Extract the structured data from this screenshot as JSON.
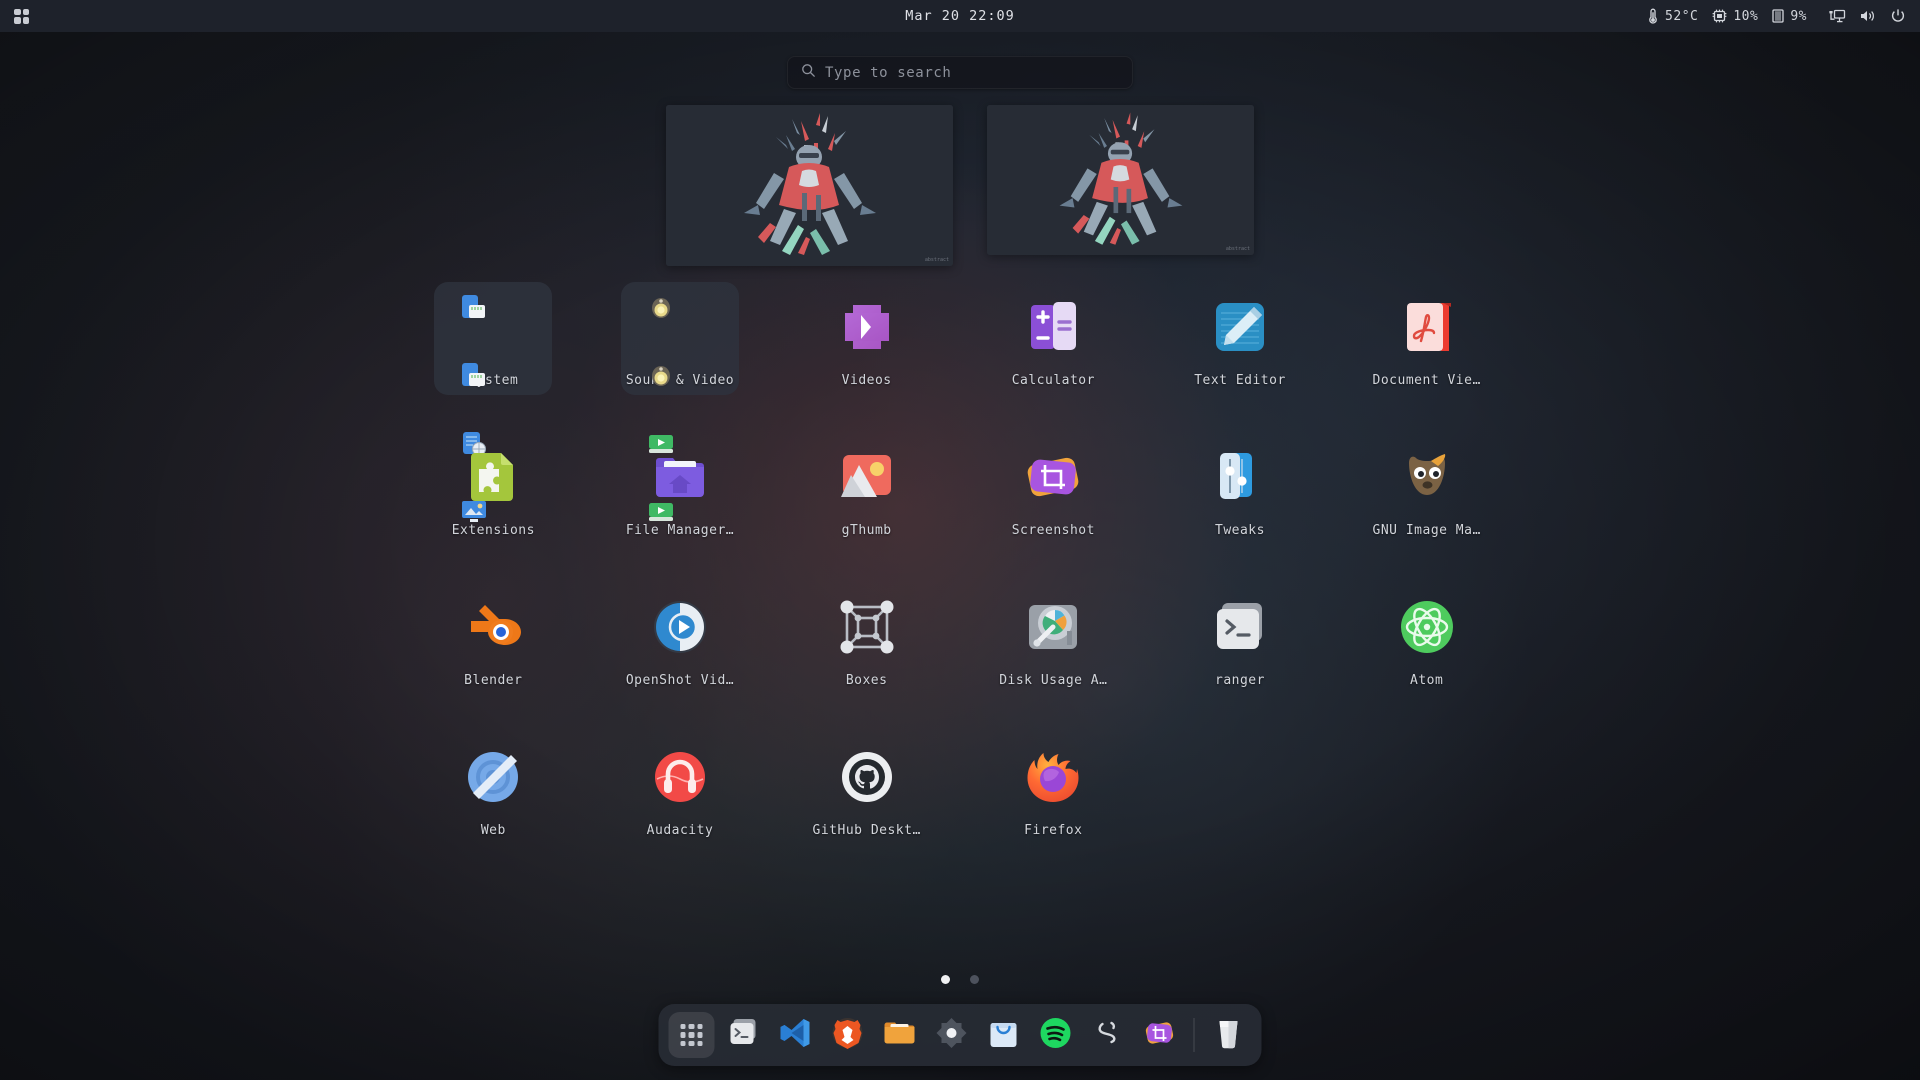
{
  "topbar": {
    "activities_icon": "grid-apps-icon",
    "clock": "Mar 20 22:09",
    "status": {
      "temperature_icon": "thermometer-icon",
      "temperature": "52°C",
      "cpu_icon": "cpu-chip-icon",
      "cpu": "10%",
      "memory_icon": "memory-icon",
      "memory": "9%",
      "network_icon": "network-wired-icon",
      "volume_icon": "speaker-volume-icon",
      "power_icon": "power-icon"
    }
  },
  "search": {
    "icon": "search-icon",
    "value": "",
    "placeholder": "Type to search"
  },
  "workspaces": [
    {
      "name": "workspace-1",
      "tag": "abstract"
    },
    {
      "name": "workspace-2",
      "tag": "abstract"
    }
  ],
  "apps": [
    {
      "label": "System",
      "icon": "folder-system-icon",
      "type": "folder"
    },
    {
      "label": "Sound & Video",
      "icon": "folder-sound-video-icon",
      "type": "folder"
    },
    {
      "label": "Videos",
      "icon": "videos-icon",
      "type": "app"
    },
    {
      "label": "Calculator",
      "icon": "calculator-icon",
      "type": "app"
    },
    {
      "label": "Text Editor",
      "icon": "text-editor-icon",
      "type": "app"
    },
    {
      "label": "Document Vie…",
      "icon": "document-viewer-icon",
      "type": "app"
    },
    {
      "label": "Extensions",
      "icon": "extensions-icon",
      "type": "app"
    },
    {
      "label": "File Manager…",
      "icon": "file-manager-icon",
      "type": "app"
    },
    {
      "label": "gThumb",
      "icon": "gthumb-icon",
      "type": "app"
    },
    {
      "label": "Screenshot",
      "icon": "screenshot-icon",
      "type": "app"
    },
    {
      "label": "Tweaks",
      "icon": "tweaks-icon",
      "type": "app"
    },
    {
      "label": "GNU Image Ma…",
      "icon": "gimp-icon",
      "type": "app"
    },
    {
      "label": "Blender",
      "icon": "blender-icon",
      "type": "app"
    },
    {
      "label": "OpenShot Vid…",
      "icon": "openshot-icon",
      "type": "app"
    },
    {
      "label": "Boxes",
      "icon": "boxes-icon",
      "type": "app"
    },
    {
      "label": "Disk Usage A…",
      "icon": "disk-usage-analyzer-icon",
      "type": "app"
    },
    {
      "label": "ranger",
      "icon": "ranger-terminal-icon",
      "type": "app"
    },
    {
      "label": "Atom",
      "icon": "atom-icon",
      "type": "app"
    },
    {
      "label": "Web",
      "icon": "gnome-web-icon",
      "type": "app"
    },
    {
      "label": "Audacity",
      "icon": "audacity-icon",
      "type": "app"
    },
    {
      "label": "GitHub Deskt…",
      "icon": "github-desktop-icon",
      "type": "app"
    },
    {
      "label": "Firefox",
      "icon": "firefox-icon",
      "type": "app"
    }
  ],
  "pages": {
    "count": 2,
    "active": 1
  },
  "dock": [
    {
      "name": "show-applications",
      "icon": "grid-apps-icon",
      "active": true
    },
    {
      "name": "terminal",
      "icon": "terminal-icon",
      "active": false
    },
    {
      "name": "vscode",
      "icon": "vscode-icon",
      "active": false
    },
    {
      "name": "brave",
      "icon": "brave-icon",
      "active": false
    },
    {
      "name": "files",
      "icon": "folder-icon",
      "active": false
    },
    {
      "name": "settings",
      "icon": "settings-icon",
      "active": false
    },
    {
      "name": "software",
      "icon": "software-bag-icon",
      "active": false
    },
    {
      "name": "spotify",
      "icon": "spotify-icon",
      "active": false
    },
    {
      "name": "blender-dock",
      "icon": "blender-icon",
      "active": false
    },
    {
      "name": "screenshot-dock",
      "icon": "screenshot-icon",
      "active": false
    },
    {
      "name": "trash",
      "icon": "trash-icon",
      "active": false
    }
  ],
  "colors": {
    "bg": "#1c1f26",
    "panel": "#1e222b",
    "dock": "#282c35",
    "text": "#d2d5db",
    "accent": "#f0f1f3"
  }
}
